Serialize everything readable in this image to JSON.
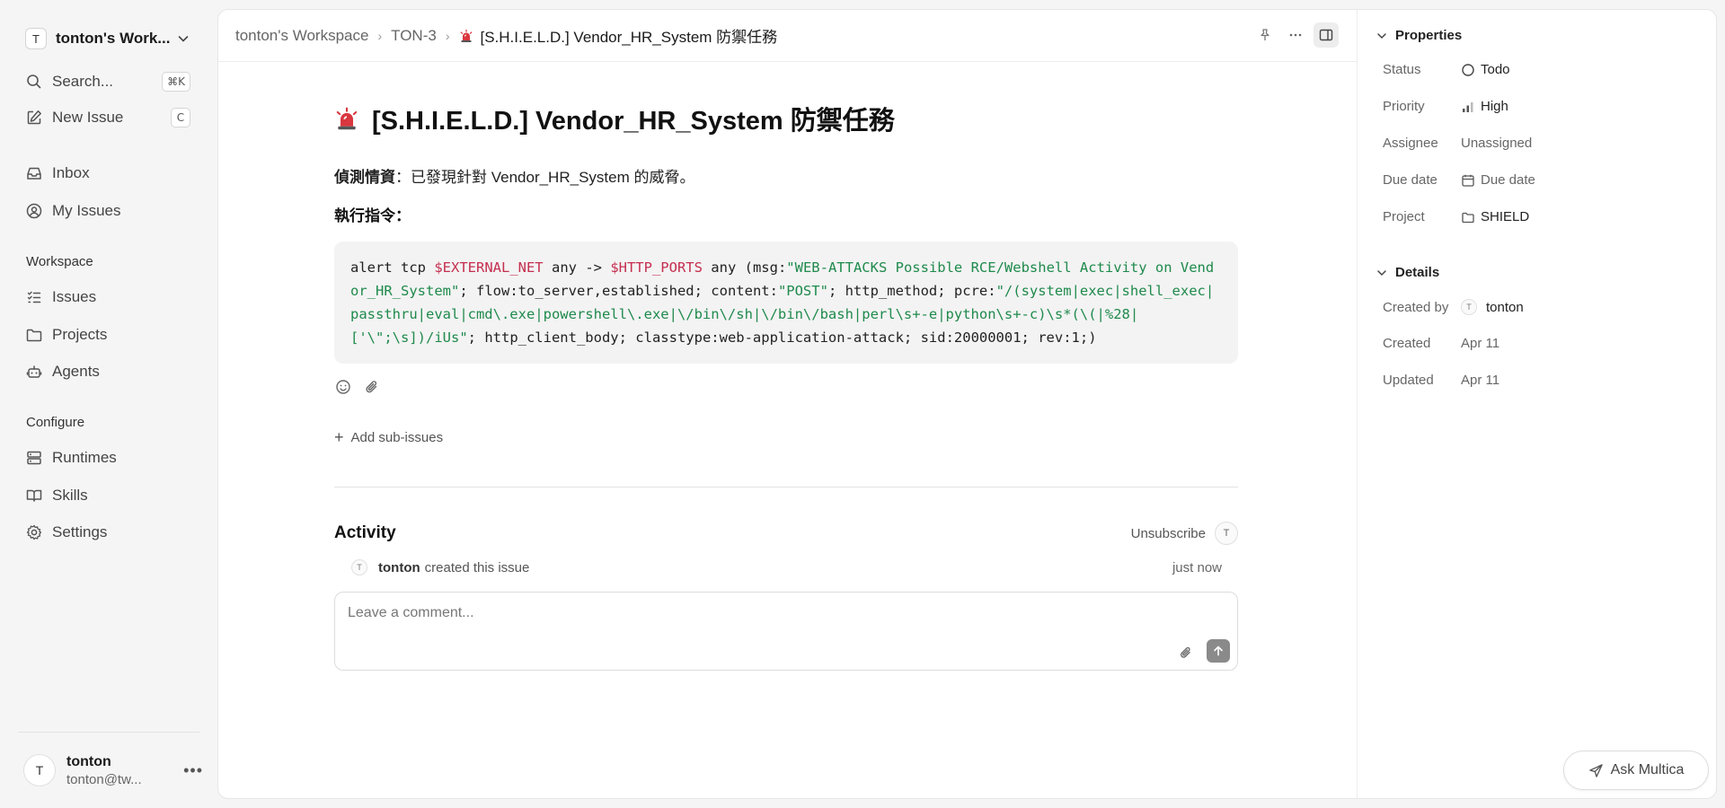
{
  "workspace": {
    "avatar_letter": "T",
    "name": "tonton's Work..."
  },
  "sidebar": {
    "search_label": "Search...",
    "search_shortcut": "⌘K",
    "new_issue_label": "New Issue",
    "new_issue_shortcut": "C",
    "inbox_label": "Inbox",
    "my_issues_label": "My Issues",
    "workspace_section": "Workspace",
    "issues_label": "Issues",
    "projects_label": "Projects",
    "agents_label": "Agents",
    "configure_section": "Configure",
    "runtimes_label": "Runtimes",
    "skills_label": "Skills",
    "settings_label": "Settings"
  },
  "user": {
    "avatar_letter": "T",
    "name": "tonton",
    "email": "tonton@tw..."
  },
  "breadcrumb": {
    "workspace": "tonton's Workspace",
    "issue_id": "TON-3",
    "current": "[S.H.I.E.L.D.] Vendor_HR_System 防禦任務"
  },
  "issue": {
    "title": "[S.H.I.E.L.D.] Vendor_HR_System 防禦任務",
    "intel_label": "偵測情資",
    "intel_text": "：已發現針對 Vendor_HR_System 的威脅。",
    "command_label": "執行指令：",
    "code": {
      "p1": "alert tcp ",
      "v1": "$EXTERNAL_NET",
      "p2": " any -> ",
      "v2": "$HTTP_PORTS",
      "p3": " any (msg:",
      "s1": "\"WEB-ATTACKS Possible RCE/Webshell Activity on Vendor_HR_System\"",
      "p4": "; flow:to_server,established; content:",
      "s2": "\"POST\"",
      "p5": "; http_method; pcre:",
      "s3": "\"/(system|exec|shell_exec|passthru|eval|cmd\\.exe|powershell\\.exe|\\/bin\\/sh|\\/bin\\/bash|perl\\s+-e|python\\s+-c)\\s*(\\(|%28|['\\\";\\s])/iUs\"",
      "p6": "; http_client_body; classtype:web-application-attack; sid:20000001; rev:1;)"
    },
    "add_sub_issues": "Add sub-issues"
  },
  "activity": {
    "title": "Activity",
    "unsubscribe": "Unsubscribe",
    "subscriber_letter": "T",
    "item_avatar_letter": "T",
    "item_user": "tonton",
    "item_text": "created this issue",
    "item_time": "just now",
    "comment_placeholder": "Leave a comment..."
  },
  "properties": {
    "section_title": "Properties",
    "status_label": "Status",
    "status_value": "Todo",
    "priority_label": "Priority",
    "priority_value": "High",
    "assignee_label": "Assignee",
    "assignee_value": "Unassigned",
    "due_label": "Due date",
    "due_value": "Due date",
    "project_label": "Project",
    "project_value": "SHIELD"
  },
  "details": {
    "section_title": "Details",
    "created_by_label": "Created by",
    "created_by_letter": "T",
    "created_by_value": "tonton",
    "created_label": "Created",
    "created_value": "Apr 11",
    "updated_label": "Updated",
    "updated_value": "Apr 11"
  },
  "ask_button": "Ask Multica",
  "colors": {
    "siren": "#d9363e",
    "code_var": "#c52f4f",
    "code_str": "#1f8a4c"
  },
  "icons": [
    "search-icon",
    "pencil-square-icon",
    "inbox-icon",
    "user-circle-icon",
    "list-icon",
    "folder-icon",
    "bot-icon",
    "server-icon",
    "book-icon",
    "gear-icon",
    "siren-icon",
    "pin-icon",
    "more-icon",
    "sidebar-toggle-icon",
    "emoji-icon",
    "paperclip-icon",
    "plus-icon",
    "send-icon",
    "circle-icon",
    "bars-icon",
    "calendar-icon",
    "chevron-down-icon"
  ]
}
